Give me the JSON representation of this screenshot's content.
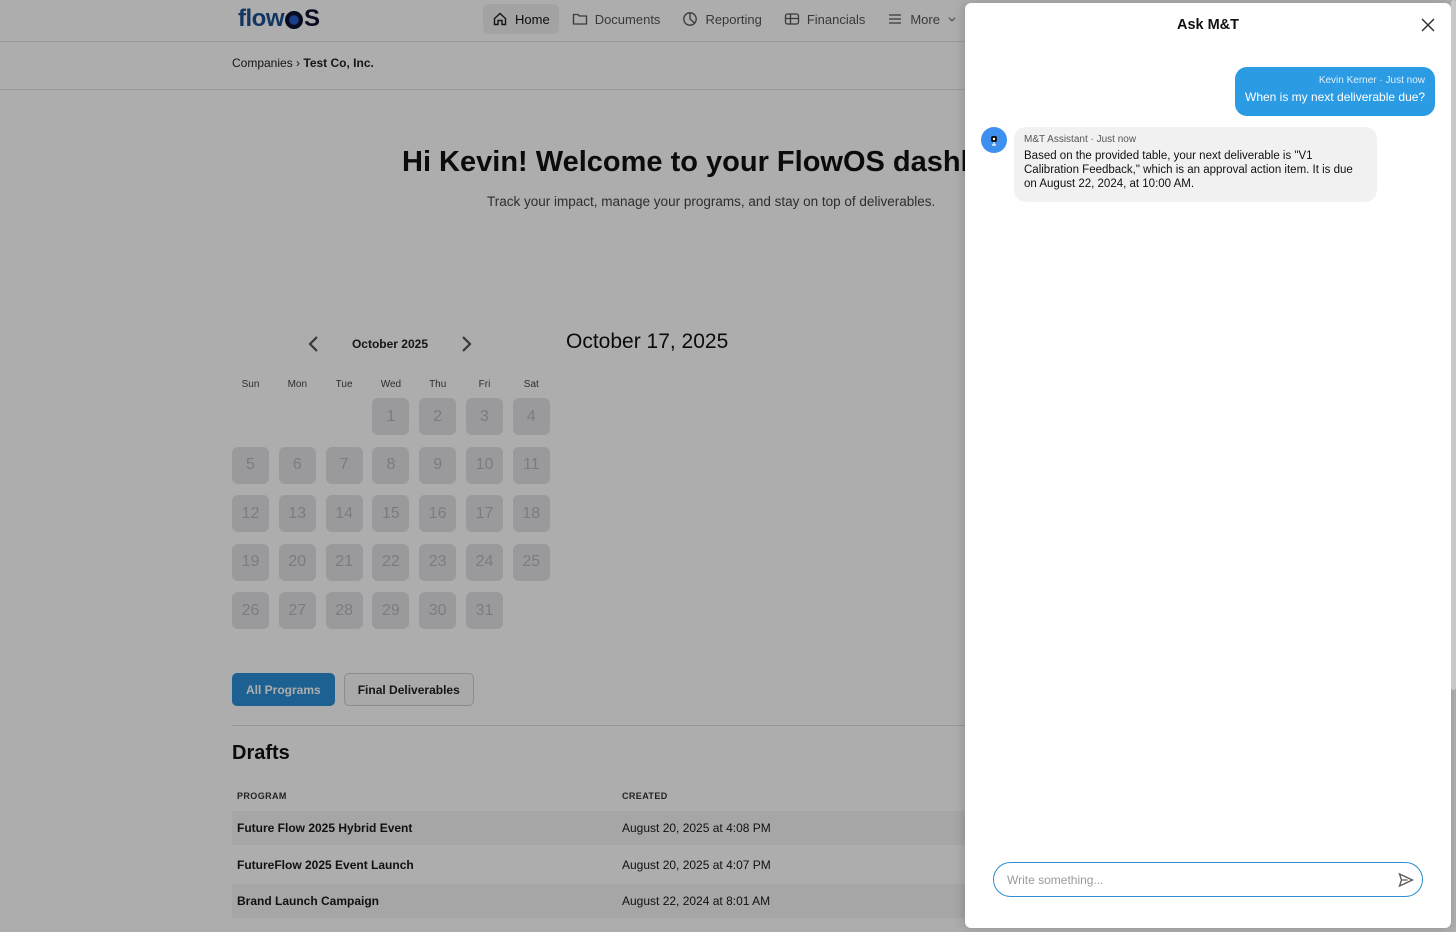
{
  "nav": {
    "logo_flow": "flow",
    "logo_os": "S",
    "items": [
      {
        "label": "Home",
        "icon": "home-icon"
      },
      {
        "label": "Documents",
        "icon": "folder-icon"
      },
      {
        "label": "Reporting",
        "icon": "pie-chart-icon"
      },
      {
        "label": "Financials",
        "icon": "wallet-icon"
      },
      {
        "label": "More",
        "icon": "menu-icon"
      }
    ]
  },
  "breadcrumb": {
    "parent": "Companies",
    "separator": "›",
    "current": "Test Co, Inc."
  },
  "hero": {
    "title": "Hi Kevin! Welcome to your FlowOS dashboard",
    "subtitle": "Track your impact, manage your programs, and stay on top of deliverables."
  },
  "calendar": {
    "month_label": "October 2025",
    "selected_date": "October 17, 2025",
    "weekdays": [
      "Sun",
      "Mon",
      "Tue",
      "Wed",
      "Thu",
      "Fri",
      "Sat"
    ],
    "first_weekday_index": 3,
    "days_in_month": 31
  },
  "program_tabs": {
    "all": "All Programs",
    "final": "Final Deliverables"
  },
  "drafts": {
    "title": "Drafts",
    "columns": {
      "program": "PROGRAM",
      "created": "CREATED"
    },
    "rows": [
      {
        "program": "Future Flow 2025 Hybrid Event",
        "created": "August 20, 2025 at 4:08 PM"
      },
      {
        "program": "FutureFlow 2025 Event Launch",
        "created": "August 20, 2025 at 4:07 PM"
      },
      {
        "program": "Brand Launch Campaign",
        "created": "August 22, 2024 at 8:01 AM"
      }
    ]
  },
  "chat": {
    "title": "Ask M&T",
    "user_message": {
      "meta": "Kevin Kerner · Just now",
      "text": "When is my next deliverable due?"
    },
    "bot_message": {
      "meta": "M&T Assistant · Just now",
      "text": "Based on the provided table, your next deliverable is \"V1 Calibration Feedback,\" which is an approval action item. It is due on August 22, 2024, at 10:00 AM."
    },
    "input_placeholder": "Write something...",
    "input_value": ""
  },
  "colors": {
    "accent": "#2b9be3",
    "primary_button": "#2a8fd6",
    "avatar": "#3d8ff0"
  }
}
